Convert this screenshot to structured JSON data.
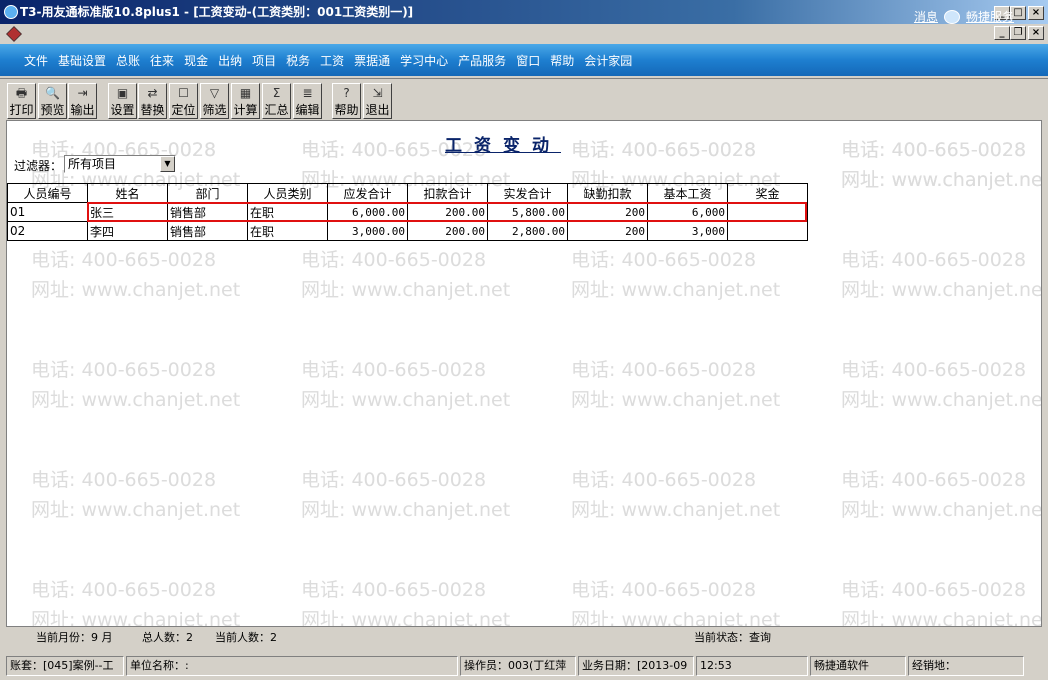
{
  "window": {
    "title": "T3-用友通标准版10.8plus1 - [工资变动-(工资类别：001工资类别一)]"
  },
  "menu": [
    "文件",
    "基础设置",
    "总账",
    "往来",
    "现金",
    "出纳",
    "项目",
    "税务",
    "工资",
    "票据通",
    "学习中心",
    "产品服务",
    "窗口",
    "帮助",
    "会计家园"
  ],
  "menu_right": {
    "messages": "消息",
    "service": "畅捷服务"
  },
  "toolbar": [
    {
      "label": "打印",
      "icon": "printer-icon",
      "glyph": "🖶"
    },
    {
      "label": "预览",
      "icon": "preview-icon",
      "glyph": "🔍"
    },
    {
      "label": "输出",
      "icon": "export-icon",
      "glyph": "⇥"
    },
    {
      "label": "设置",
      "icon": "settings-icon",
      "glyph": "▣"
    },
    {
      "label": "替换",
      "icon": "replace-icon",
      "glyph": "⇄"
    },
    {
      "label": "定位",
      "icon": "locate-icon",
      "glyph": "☐"
    },
    {
      "label": "筛选",
      "icon": "filter-icon",
      "glyph": "▽"
    },
    {
      "label": "计算",
      "icon": "calculate-icon",
      "glyph": "▦"
    },
    {
      "label": "汇总",
      "icon": "sum-icon",
      "glyph": "Σ"
    },
    {
      "label": "编辑",
      "icon": "edit-icon",
      "glyph": "≣"
    },
    {
      "label": "帮助",
      "icon": "help-icon",
      "glyph": "?"
    },
    {
      "label": "退出",
      "icon": "exit-icon",
      "glyph": "⇲"
    }
  ],
  "page_title": "工资变动",
  "filter": {
    "label": "过滤器：",
    "value": "所有项目"
  },
  "table": {
    "columns": [
      "人员编号",
      "姓名",
      "部门",
      "人员类别",
      "应发合计",
      "扣款合计",
      "实发合计",
      "缺勤扣款",
      "基本工资",
      "奖金"
    ],
    "rows": [
      [
        "01",
        "张三",
        "销售部",
        "在职",
        "6,000.00",
        "200.00",
        "5,800.00",
        "200",
        "6,000",
        ""
      ],
      [
        "02",
        "李四",
        "销售部",
        "在职",
        "3,000.00",
        "200.00",
        "2,800.00",
        "200",
        "3,000",
        ""
      ]
    ]
  },
  "info": {
    "month": "当前月份：9 月",
    "total": "总人数：2",
    "current": "当前人数：2",
    "status": "当前状态：查询"
  },
  "statusbar": [
    "账套：[045]案例--工",
    "单位名称：:",
    "操作员：003(丁红萍",
    "业务日期：[2013-09",
    "12:53",
    "畅捷通软件",
    "经销地："
  ],
  "watermark": {
    "phone": "电话: 400-665-0028",
    "url": "网址: www.chanjet.net"
  },
  "colors": {
    "highlight": "#e01010",
    "menubar": "#1e7fd0",
    "titlebar": "#0a246a"
  }
}
